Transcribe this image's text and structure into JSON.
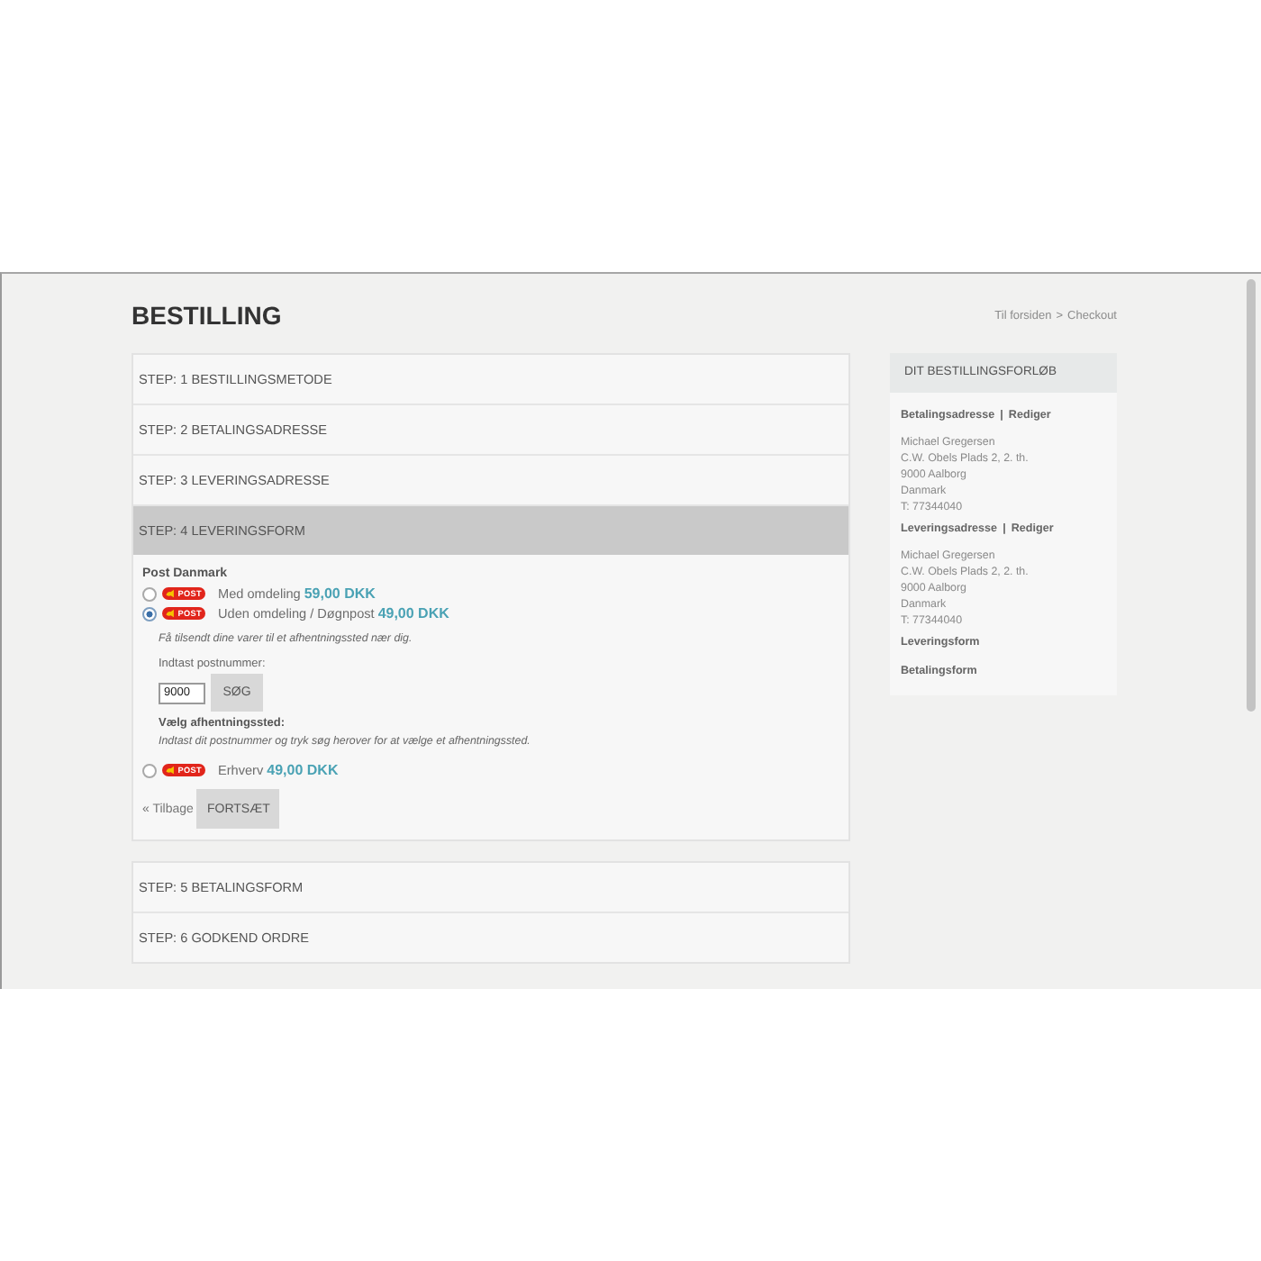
{
  "header": {
    "title": "BESTILLING",
    "breadcrumb": {
      "link": "Til forsiden",
      "separator": ">",
      "current": "Checkout"
    }
  },
  "steps": [
    {
      "label": "STEP: 1 BESTILLINGSMETODE",
      "selected": false
    },
    {
      "label": "STEP: 2 BETALINGSADRESSE",
      "selected": false
    },
    {
      "label": "STEP: 3 LEVERINGSADRESSE",
      "selected": false
    },
    {
      "label": "STEP: 4 LEVERINGSFORM",
      "selected": true
    },
    {
      "label": "STEP: 5 BETALINGSFORM",
      "selected": false
    },
    {
      "label": "STEP: 6 GODKEND ORDRE",
      "selected": false
    }
  ],
  "shipping": {
    "carrier": "Post Danmark",
    "options": [
      {
        "logo": "POST",
        "label": "Med omdeling",
        "price": "59,00 DKK",
        "selected": false
      },
      {
        "logo": "POST",
        "label": "Uden omdeling / Døgnpost",
        "price": "49,00 DKK",
        "selected": true,
        "details": {
          "note": "Få tilsendt dine varer til et afhentningssted nær dig.",
          "postcode_label": "Indtast postnummer:",
          "postcode": "9000",
          "search_button": "SØG",
          "pickup_label": "Vælg afhentningssted:",
          "pickup_hint": "Indtast dit postnummer og tryk søg herover for at vælge et afhentningssted."
        }
      },
      {
        "logo": "POST",
        "label": "Erhverv",
        "price": "49,00 DKK",
        "selected": false
      }
    ],
    "back_link": "« Tilbage",
    "continue_button": "FORTSÆT"
  },
  "summary": {
    "title": "DIT BESTILLINGSFORLØB",
    "sections": [
      {
        "heading": "Betalingsadresse",
        "separator": "|",
        "link": "Rediger",
        "lines": [
          "Michael Gregersen",
          "C.W. Obels Plads 2, 2. th.",
          "9000 Aalborg",
          "Danmark",
          "T: 77344040"
        ]
      },
      {
        "heading": "Leveringsadresse",
        "separator": "|",
        "link": "Rediger",
        "lines": [
          "Michael Gregersen",
          "C.W. Obels Plads 2, 2. th.",
          "9000 Aalborg",
          "Danmark",
          "T: 77344040"
        ]
      },
      {
        "heading": "Leveringsform"
      },
      {
        "heading": "Betalingsform"
      }
    ]
  }
}
